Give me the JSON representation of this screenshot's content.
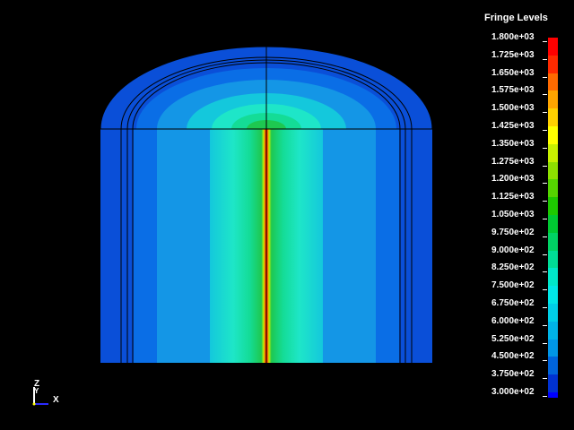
{
  "legend": {
    "title": "Fringe Levels",
    "levels": [
      {
        "label": "1.800e+03",
        "color": "#ff0000"
      },
      {
        "label": "1.725e+03",
        "color": "#ff2a00"
      },
      {
        "label": "1.650e+03",
        "color": "#ff6a00"
      },
      {
        "label": "1.575e+03",
        "color": "#ffa500"
      },
      {
        "label": "1.500e+03",
        "color": "#ffd000"
      },
      {
        "label": "1.425e+03",
        "color": "#ffff00"
      },
      {
        "label": "1.350e+03",
        "color": "#c8f000"
      },
      {
        "label": "1.275e+03",
        "color": "#8ee000"
      },
      {
        "label": "1.200e+03",
        "color": "#55d400"
      },
      {
        "label": "1.125e+03",
        "color": "#1ec800"
      },
      {
        "label": "1.050e+03",
        "color": "#00c832"
      },
      {
        "label": "9.750e+02",
        "color": "#00d264"
      },
      {
        "label": "9.000e+02",
        "color": "#00dc96"
      },
      {
        "label": "8.250e+02",
        "color": "#00e6c8"
      },
      {
        "label": "7.500e+02",
        "color": "#00e6e6"
      },
      {
        "label": "6.750e+02",
        "color": "#00cfe6"
      },
      {
        "label": "6.000e+02",
        "color": "#00b4e6"
      },
      {
        "label": "5.250e+02",
        "color": "#0096e6"
      },
      {
        "label": "4.500e+02",
        "color": "#0064dc"
      },
      {
        "label": "3.750e+02",
        "color": "#0032d2"
      },
      {
        "label": "3.000e+02",
        "color": "#0000ff"
      }
    ]
  },
  "triad": {
    "z": "Z",
    "y": "Y",
    "x": "X"
  },
  "colors": {
    "background": "#000000",
    "outer_blue": "#0a4fd8",
    "band2": "#0a6ee6",
    "band3": "#1496e6",
    "band4": "#14c8dc",
    "band5": "#1ee6c8",
    "band6": "#14dc96",
    "band7": "#1ec850",
    "center": "#ff0000",
    "edge_line": "#000000"
  }
}
